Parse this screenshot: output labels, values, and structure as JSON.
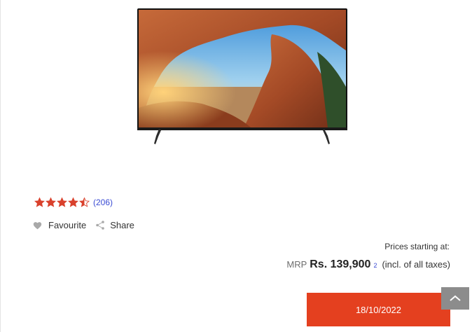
{
  "product": {
    "image_icon": "tv-product-image",
    "rating": {
      "value": 4.5,
      "max": 5,
      "reviews_label": "(206)"
    }
  },
  "actions": {
    "favourite_label": "Favourite",
    "share_label": "Share"
  },
  "pricing": {
    "note": "Prices starting at:",
    "mrp_label": "MRP",
    "price": "Rs. 139,900",
    "footnote": "2",
    "taxes_label": "(incl. of all taxes)"
  },
  "cta": {
    "label": "18/10/2022"
  },
  "colors": {
    "accent": "#e4401f",
    "star": "#d9412c",
    "link": "#3a4bd3",
    "scroll_button": "#8c8c8c"
  }
}
